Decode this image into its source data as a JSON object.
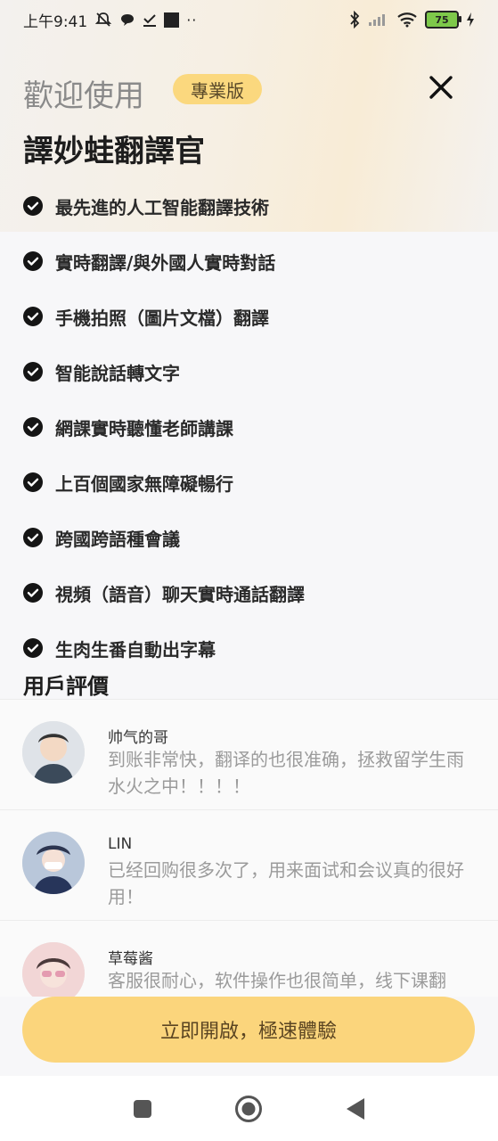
{
  "status_bar": {
    "time": "上午9:41",
    "battery": "75",
    "colors": {
      "battery_fill": "#7ec94a"
    }
  },
  "header": {
    "welcome": "歡迎使用",
    "badge": "專業版",
    "close_icon": "close-icon"
  },
  "app_title": "譯妙蛙翻譯官",
  "features": [
    "最先進的人工智能翻譯技術",
    "實時翻譯/與外國人實時對話",
    "手機拍照（圖片文檔）翻譯",
    "智能說話轉文字",
    "網課實時聽懂老師講課",
    "上百個國家無障礙暢行",
    "跨國跨語種會議",
    "視頻（語音）聊天實時通話翻譯",
    "生肉生番自動出字幕"
  ],
  "reviews_title": "用戶評價",
  "reviews": [
    {
      "name": "帅气的哥",
      "text": "到账非常快，翻译的也很准确，拯救留学生雨水火之中！！！！"
    },
    {
      "name": "LIN",
      "text": "已经回购很多次了，用来面试和会议真的很好用！"
    },
    {
      "name": "草莓酱",
      "text": "客服很耐心，软件操作也很简单，线下课翻"
    }
  ],
  "cta_label": "立即開啟，極速體驗",
  "nav": {
    "icons": [
      "recent-apps-icon",
      "home-icon",
      "back-icon"
    ]
  },
  "colors": {
    "accent": "#fbd57c",
    "badge": "#fbd87e"
  }
}
